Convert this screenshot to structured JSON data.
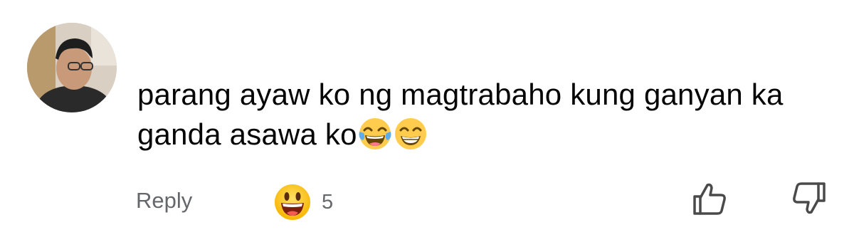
{
  "comment": {
    "text_line1": "parang ayaw ko ng magtrabaho kung ganyan ka",
    "text_line2": "ganda asawa ko",
    "inline_emojis": [
      "face-with-tears-of-joy",
      "beaming-face-with-smiling-eyes"
    ]
  },
  "actions": {
    "reply_label": "Reply",
    "reaction_icon": "grinning-face-emoji",
    "reaction_count": "5",
    "like_icon": "thumbs-up-outline-icon",
    "dislike_icon": "thumbs-down-outline-icon"
  },
  "colors": {
    "text": "#050505",
    "secondary_text": "#65676b",
    "emoji_yellow": "#ffcc4d",
    "emoji_mouth": "#c0392b"
  }
}
